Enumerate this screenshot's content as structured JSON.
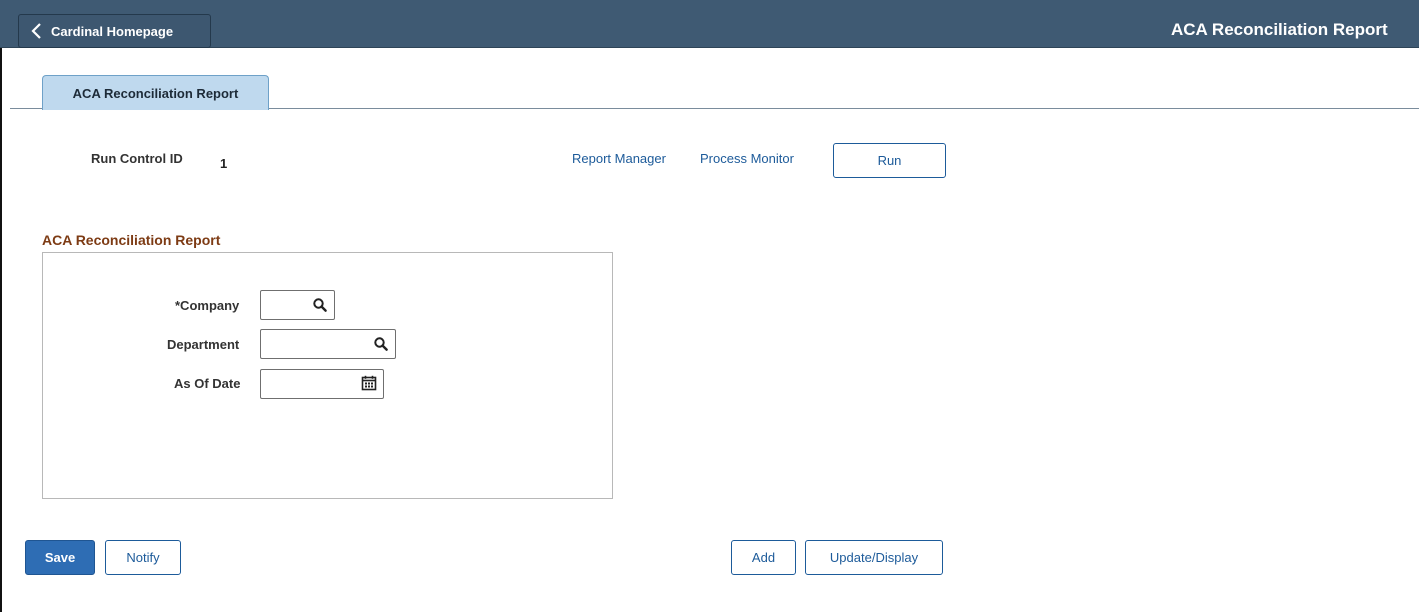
{
  "header": {
    "back_label": "Cardinal Homepage",
    "title": "ACA Reconciliation Report"
  },
  "tabs": [
    {
      "label": "ACA Reconciliation Report"
    }
  ],
  "run_control": {
    "label": "Run Control ID",
    "value": "1"
  },
  "links": {
    "report_manager": "Report Manager",
    "process_monitor": "Process Monitor"
  },
  "run_button": "Run",
  "section": {
    "title": "ACA Reconciliation Report",
    "fields": {
      "company": {
        "label": "*Company",
        "value": "",
        "icon": "search-icon"
      },
      "department": {
        "label": "Department",
        "value": "",
        "icon": "search-icon"
      },
      "as_of_date": {
        "label": "As Of Date",
        "value": "",
        "icon": "calendar-icon"
      }
    }
  },
  "footer": {
    "save": "Save",
    "notify": "Notify",
    "add": "Add",
    "update_display": "Update/Display"
  },
  "colors": {
    "banner": "#3f5a73",
    "tab_active": "#bfd9ee",
    "link": "#1d5b9a",
    "primary_button": "#2e6db4",
    "section_title": "#7d3b14"
  }
}
